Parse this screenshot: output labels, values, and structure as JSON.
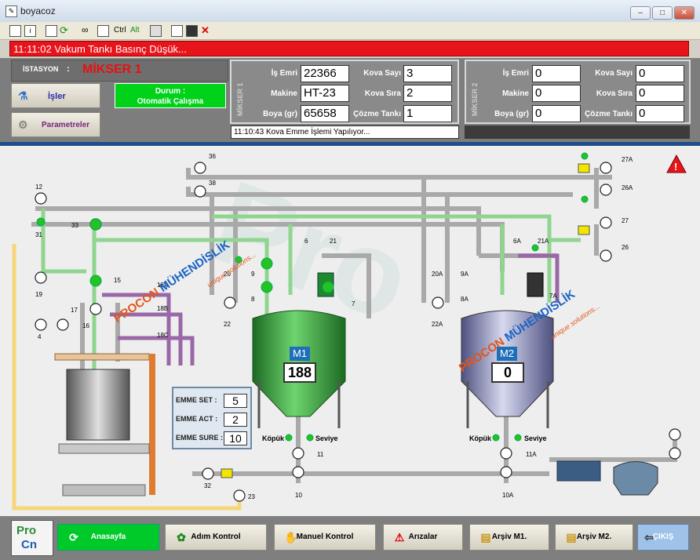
{
  "window": {
    "title": "boyacoz"
  },
  "toolbar": {
    "ctrl": "Ctrl",
    "alt": "Alt"
  },
  "alarm": {
    "message": "11:11:02 Vakum Tankı Basınç Düşük..."
  },
  "station": {
    "label": "İSTASYON",
    "sep": ":",
    "name": "MİKSER 1"
  },
  "buttons_left": {
    "isler": "İşler",
    "parametreler": "Parametreler"
  },
  "status": {
    "line1": "Durum :",
    "line2": "Otomatik Çalışma"
  },
  "mikser1": {
    "vertical_label": "MİKSER 1",
    "is_emri_label": "İş Emri",
    "is_emri": "22366",
    "makine_label": "Makine",
    "makine": "HT-23",
    "boya_label": "Boya (gr)",
    "boya": "65658",
    "kova_sayi_label": "Kova Sayı",
    "kova_sayi": "3",
    "kova_sira_label": "Kova Sıra",
    "kova_sira": "2",
    "cozme_label": "Çözme Tankı",
    "cozme": "1"
  },
  "mikser2": {
    "vertical_label": "MİKSER 2",
    "is_emri_label": "İş Emri",
    "is_emri": "0",
    "makine_label": "Makine",
    "makine": "0",
    "boya_label": "Boya (gr)",
    "boya": "0",
    "kova_sayi_label": "Kova Sayı",
    "kova_sayi": "0",
    "kova_sira_label": "Kova Sıra",
    "kova_sira": "0",
    "cozme_label": "Çözme Tankı",
    "cozme": "0"
  },
  "message_line": "11:10:43 Kova Emme İşlemi Yapılıyor...",
  "emme": {
    "set_label": "EMME SET :",
    "set": "5",
    "act_label": "EMME ACT :",
    "act": "2",
    "sure_label": "EMME SURE :",
    "sure": "10"
  },
  "tanks": {
    "m1_label": "M1",
    "m1_value": "188",
    "m2_label": "M2",
    "m2_value": "0",
    "kopuk": "Köpük",
    "seviye": "Seviye"
  },
  "watermark": {
    "brand_a": "PROCON",
    "brand_b": "MÜHENDİSLİK",
    "slogan": "unique solutions..."
  },
  "valve_tags": [
    "36",
    "38",
    "12",
    "31",
    "33",
    "19",
    "15",
    "17",
    "16",
    "4",
    "18A",
    "18B",
    "18C",
    "20",
    "9",
    "8",
    "6",
    "21",
    "7",
    "22",
    "20A",
    "9A",
    "8A",
    "6A",
    "21A",
    "7A",
    "22A",
    "27A",
    "26A",
    "27",
    "26",
    "11",
    "11A",
    "10",
    "10A",
    "32",
    "23"
  ],
  "bottom": {
    "logo_a": "Pro",
    "logo_b": "Cn",
    "anasayfa": "Anasayfa",
    "adim": "Adım  Kontrol",
    "manuel": "Manuel Kontrol",
    "arizalar": "Arızalar",
    "arsiv1": "Arşiv M1.",
    "arsiv2": "Arşiv M2.",
    "cikis": "ÇIKIŞ"
  },
  "colors": {
    "alarm": "#e8141c",
    "status_green": "#00d21a",
    "tank1": "#2e9b36",
    "tank2": "#8c8fb8",
    "accent_blue": "#1e4f8a"
  }
}
